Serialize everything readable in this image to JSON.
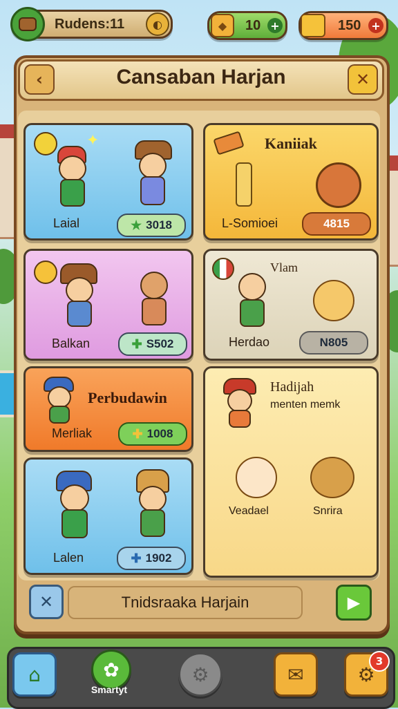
{
  "top_bar": {
    "player_label": "Rudens:11",
    "currency_green": "10",
    "currency_gold": "150"
  },
  "board": {
    "title": "Cansaban Harjan"
  },
  "cards": [
    {
      "label": "Laial",
      "price": "3018",
      "color": "#7fc8ee"
    },
    {
      "title": "Kaniiak",
      "label": "L-Somioei",
      "price": "4815",
      "color": "#f7c64a"
    },
    {
      "label": "Balkan",
      "price": "S502",
      "color": "#e9a8e6"
    },
    {
      "title": "Vlam",
      "label": "Herdao",
      "price": "N805",
      "color": "#e6e0cc"
    },
    {
      "title": "Perbudawin",
      "label": "Merliak",
      "price": "1008",
      "color": "#f58a3a"
    },
    {
      "title": "Hadijah",
      "subtitle": "menten memk",
      "items": [
        "Veadael",
        "Snrira"
      ],
      "color": "#fbe3a0"
    },
    {
      "label": "Lalen",
      "price": "1902",
      "color": "#7fc8ee"
    }
  ],
  "footer": {
    "bar_label": "Tnidsraaka Harjain"
  },
  "nav": {
    "items": [
      {
        "label": ""
      },
      {
        "label": "Smartyt"
      },
      {
        "label": ""
      },
      {
        "label": ""
      },
      {
        "label": "",
        "badge": "3"
      }
    ]
  },
  "icons": {
    "back": "chevron-left-icon",
    "close": "close-icon",
    "play": "play-icon",
    "home": "home-icon",
    "settings": "gear-icon",
    "shop": "cart-icon"
  }
}
